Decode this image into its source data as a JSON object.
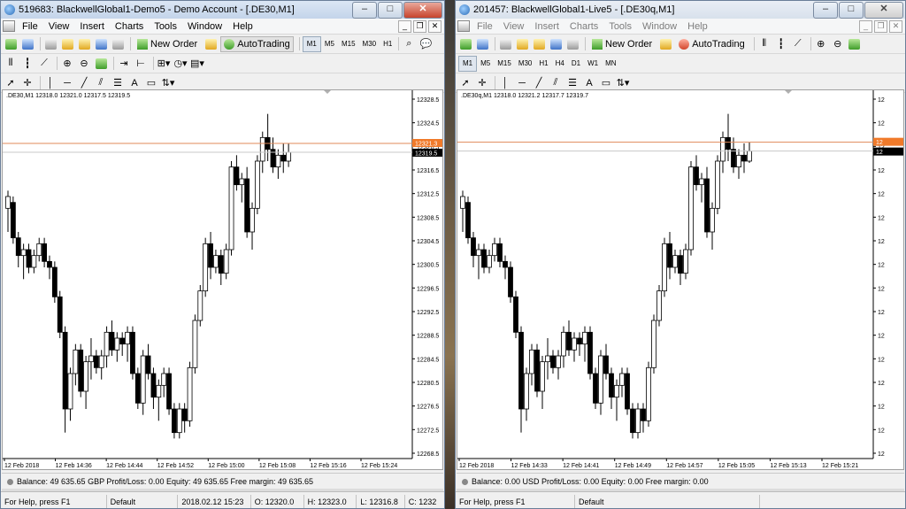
{
  "colors": {
    "accent_line": "#e08a5a",
    "bid_label": "#f07a2a",
    "last_label": "#000000",
    "candle_up": "#ffffff",
    "candle_down": "#000000"
  },
  "left": {
    "title": "519683: BlackwellGlobal1-Demo5 - Demo Account - [.DE30,M1]",
    "menu": [
      "File",
      "View",
      "Insert",
      "Charts",
      "Tools",
      "Window",
      "Help"
    ],
    "toolbar": {
      "new_order": "New Order",
      "autotrading": "AutoTrading"
    },
    "timeframes": [
      "M1",
      "M5",
      "M15",
      "M30",
      "H1"
    ],
    "chart": {
      "symbol_line": ".DE30,M1  12318.0 12321.0 12317.5 12319.5",
      "price_labels": [
        "12328.5",
        "12324.5",
        "12320.5",
        "12316.5",
        "12312.5",
        "12308.5",
        "12304.5",
        "12300.5",
        "12296.5",
        "12292.5",
        "12288.5",
        "12284.5",
        "12280.5",
        "12276.5",
        "12272.5",
        "12268.5"
      ],
      "time_labels": [
        "12 Feb 2018",
        "12 Feb 14:36",
        "12 Feb 14:44",
        "12 Feb 14:52",
        "12 Feb 15:00",
        "12 Feb 15:08",
        "12 Feb 15:16",
        "12 Feb 15:24"
      ],
      "bid_marker": "12321.3",
      "last_marker": "12319.5"
    },
    "balance": "Balance: 49 635.65 GBP  Profit/Loss: 0.00  Equity: 49 635.65  Free margin: 49 635.65",
    "status": {
      "help": "For Help, press F1",
      "profile": "Default",
      "datetime": "2018.02.12 15:23",
      "open": "O: 12320.0",
      "high": "H: 12323.0",
      "low": "L: 12316.8",
      "close": "C: 1232"
    }
  },
  "right": {
    "title": "201457: BlackwellGlobal1-Live5 - [.DE30q,M1]",
    "menu": [
      "File",
      "View",
      "Insert",
      "Charts",
      "Tools",
      "Window",
      "Help"
    ],
    "toolbar": {
      "new_order": "New Order",
      "autotrading": "AutoTrading"
    },
    "timeframes": [
      "M1",
      "M5",
      "M15",
      "M30",
      "H1",
      "H4",
      "D1",
      "W1",
      "MN"
    ],
    "chart": {
      "symbol_line": ".DE30q,M1  12318.0 12321.2 12317.7 12319.7",
      "price_labels": [
        "12",
        "12",
        "12",
        "12",
        "12",
        "12",
        "12",
        "12",
        "12",
        "12",
        "12",
        "12",
        "12",
        "12",
        "12",
        "12"
      ],
      "time_labels": [
        "12 Feb 2018",
        "12 Feb 14:33",
        "12 Feb 14:41",
        "12 Feb 14:49",
        "12 Feb 14:57",
        "12 Feb 15:05",
        "12 Feb 15:13",
        "12 Feb 15:21"
      ],
      "bid_marker": "12",
      "last_marker": "12"
    },
    "balance": "Balance: 0.00 USD  Profit/Loss: 0.00  Equity: 0.00  Free margin: 0.00",
    "status": {
      "help": "For Help, press F1",
      "profile": "Default"
    }
  },
  "chart_data": [
    {
      "type": "candlestick",
      "title": ".DE30,M1",
      "ylim": [
        12268.5,
        12328.5
      ],
      "candles": [
        [
          12310,
          12313,
          12306,
          12312
        ],
        [
          12311,
          12312,
          12304,
          12305
        ],
        [
          12305,
          12306,
          12300,
          12302
        ],
        [
          12302,
          12304,
          12298,
          12303
        ],
        [
          12303,
          12304,
          12299,
          12300
        ],
        [
          12300,
          12303,
          12299,
          12302
        ],
        [
          12302,
          12305,
          12301,
          12304
        ],
        [
          12304,
          12305,
          12300,
          12301
        ],
        [
          12301,
          12302,
          12298,
          12300
        ],
        [
          12300,
          12301,
          12294,
          12295
        ],
        [
          12295,
          12296,
          12288,
          12289
        ],
        [
          12289,
          12290,
          12272,
          12276
        ],
        [
          12276,
          12283,
          12274,
          12282
        ],
        [
          12282,
          12287,
          12280,
          12286
        ],
        [
          12286,
          12287,
          12278,
          12279
        ],
        [
          12279,
          12285,
          12276,
          12284
        ],
        [
          12284,
          12288,
          12281,
          12285
        ],
        [
          12285,
          12286,
          12282,
          12283
        ],
        [
          12283,
          12286,
          12281,
          12285
        ],
        [
          12285,
          12290,
          12283,
          12289
        ],
        [
          12289,
          12291,
          12285,
          12286
        ],
        [
          12286,
          12289,
          12284,
          12288
        ],
        [
          12288,
          12289,
          12285,
          12287
        ],
        [
          12287,
          12290,
          12284,
          12289
        ],
        [
          12289,
          12290,
          12281,
          12282
        ],
        [
          12282,
          12283,
          12276,
          12277
        ],
        [
          12277,
          12286,
          12275,
          12285
        ],
        [
          12285,
          12287,
          12281,
          12282
        ],
        [
          12282,
          12283,
          12276,
          12278
        ],
        [
          12278,
          12281,
          12274,
          12280
        ],
        [
          12280,
          12283,
          12278,
          12282
        ],
        [
          12282,
          12283,
          12275,
          12276
        ],
        [
          12276,
          12277,
          12271,
          12272
        ],
        [
          12272,
          12277,
          12271,
          12276
        ],
        [
          12276,
          12277,
          12272,
          12274
        ],
        [
          12274,
          12284,
          12273,
          12283
        ],
        [
          12283,
          12292,
          12282,
          12291
        ],
        [
          12291,
          12297,
          12290,
          12296
        ],
        [
          12296,
          12305,
          12295,
          12304
        ],
        [
          12304,
          12306,
          12298,
          12300
        ],
        [
          12300,
          12303,
          12299,
          12302
        ],
        [
          12302,
          12303,
          12297,
          12299
        ],
        [
          12299,
          12304,
          12298,
          12303
        ],
        [
          12303,
          12318,
          12302,
          12317
        ],
        [
          12317,
          12319,
          12313,
          12314
        ],
        [
          12314,
          12316,
          12311,
          12315
        ],
        [
          12315,
          12317,
          12305,
          12306
        ],
        [
          12306,
          12311,
          12303,
          12310
        ],
        [
          12310,
          12319,
          12309,
          12318
        ],
        [
          12318,
          12323,
          12316,
          12322
        ],
        [
          12322,
          12326,
          12318,
          12320
        ],
        [
          12320,
          12322,
          12316,
          12317
        ],
        [
          12317,
          12320,
          12315,
          12319
        ],
        [
          12319,
          12321,
          12316,
          12318
        ],
        [
          12318,
          12321,
          12317,
          12319.5
        ]
      ]
    },
    {
      "type": "candlestick",
      "title": ".DE30q,M1",
      "ylim": [
        12268.5,
        12328.5
      ],
      "candles": [
        [
          12310,
          12313,
          12306,
          12312
        ],
        [
          12311,
          12312,
          12304,
          12305
        ],
        [
          12305,
          12306,
          12300,
          12302
        ],
        [
          12302,
          12304,
          12298,
          12303
        ],
        [
          12303,
          12304,
          12299,
          12300
        ],
        [
          12300,
          12303,
          12299,
          12302
        ],
        [
          12302,
          12305,
          12301,
          12304
        ],
        [
          12304,
          12305,
          12300,
          12301
        ],
        [
          12301,
          12302,
          12298,
          12300
        ],
        [
          12300,
          12301,
          12294,
          12295
        ],
        [
          12295,
          12296,
          12288,
          12289
        ],
        [
          12289,
          12290,
          12272,
          12276
        ],
        [
          12276,
          12283,
          12274,
          12282
        ],
        [
          12282,
          12287,
          12280,
          12286
        ],
        [
          12286,
          12287,
          12278,
          12279
        ],
        [
          12279,
          12285,
          12276,
          12284
        ],
        [
          12284,
          12288,
          12281,
          12285
        ],
        [
          12285,
          12286,
          12282,
          12283
        ],
        [
          12283,
          12286,
          12281,
          12285
        ],
        [
          12285,
          12290,
          12283,
          12289
        ],
        [
          12289,
          12291,
          12285,
          12286
        ],
        [
          12286,
          12289,
          12284,
          12288
        ],
        [
          12288,
          12289,
          12285,
          12287
        ],
        [
          12287,
          12290,
          12284,
          12289
        ],
        [
          12289,
          12290,
          12281,
          12282
        ],
        [
          12282,
          12283,
          12276,
          12277
        ],
        [
          12277,
          12286,
          12275,
          12285
        ],
        [
          12285,
          12287,
          12281,
          12282
        ],
        [
          12282,
          12283,
          12276,
          12278
        ],
        [
          12278,
          12281,
          12274,
          12280
        ],
        [
          12280,
          12283,
          12278,
          12282
        ],
        [
          12282,
          12283,
          12275,
          12276
        ],
        [
          12276,
          12277,
          12271,
          12272
        ],
        [
          12272,
          12277,
          12271,
          12276
        ],
        [
          12276,
          12277,
          12272,
          12274
        ],
        [
          12274,
          12284,
          12273,
          12283
        ],
        [
          12283,
          12292,
          12282,
          12291
        ],
        [
          12291,
          12297,
          12290,
          12296
        ],
        [
          12296,
          12305,
          12295,
          12304
        ],
        [
          12304,
          12306,
          12298,
          12300
        ],
        [
          12300,
          12303,
          12299,
          12302
        ],
        [
          12302,
          12303,
          12297,
          12299
        ],
        [
          12299,
          12304,
          12298,
          12303
        ],
        [
          12303,
          12318,
          12302,
          12317
        ],
        [
          12317,
          12319,
          12313,
          12314
        ],
        [
          12314,
          12316,
          12311,
          12315
        ],
        [
          12315,
          12317,
          12305,
          12306
        ],
        [
          12306,
          12311,
          12303,
          12310
        ],
        [
          12310,
          12319,
          12309,
          12318
        ],
        [
          12318,
          12323,
          12316,
          12322
        ],
        [
          12322,
          12326,
          12318,
          12320
        ],
        [
          12320,
          12322,
          12316,
          12317
        ],
        [
          12317,
          12320,
          12315,
          12319
        ],
        [
          12319,
          12321,
          12316,
          12318
        ],
        [
          12318,
          12321.2,
          12317.7,
          12319.7
        ]
      ]
    }
  ]
}
